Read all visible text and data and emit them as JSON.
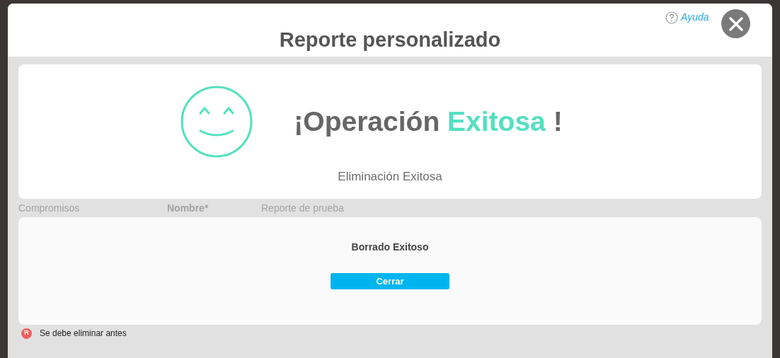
{
  "modal": {
    "title": "Reporte personalizado",
    "help_link": "Ayuda"
  },
  "result_card": {
    "headline_start": "¡Operación",
    "headline_accent": "Exitosa",
    "headline_end": "!",
    "message": "Eliminación Exitosa"
  },
  "background_form": {
    "menu_item": "Compromisos",
    "field_label": "Nombre*",
    "field_value": "Reporte de prueba"
  },
  "confirm_card": {
    "message": "Borrado Exitoso",
    "button": "Cerrar"
  },
  "legend": {
    "badge": "R",
    "text": "Se debe eliminar antes"
  }
}
